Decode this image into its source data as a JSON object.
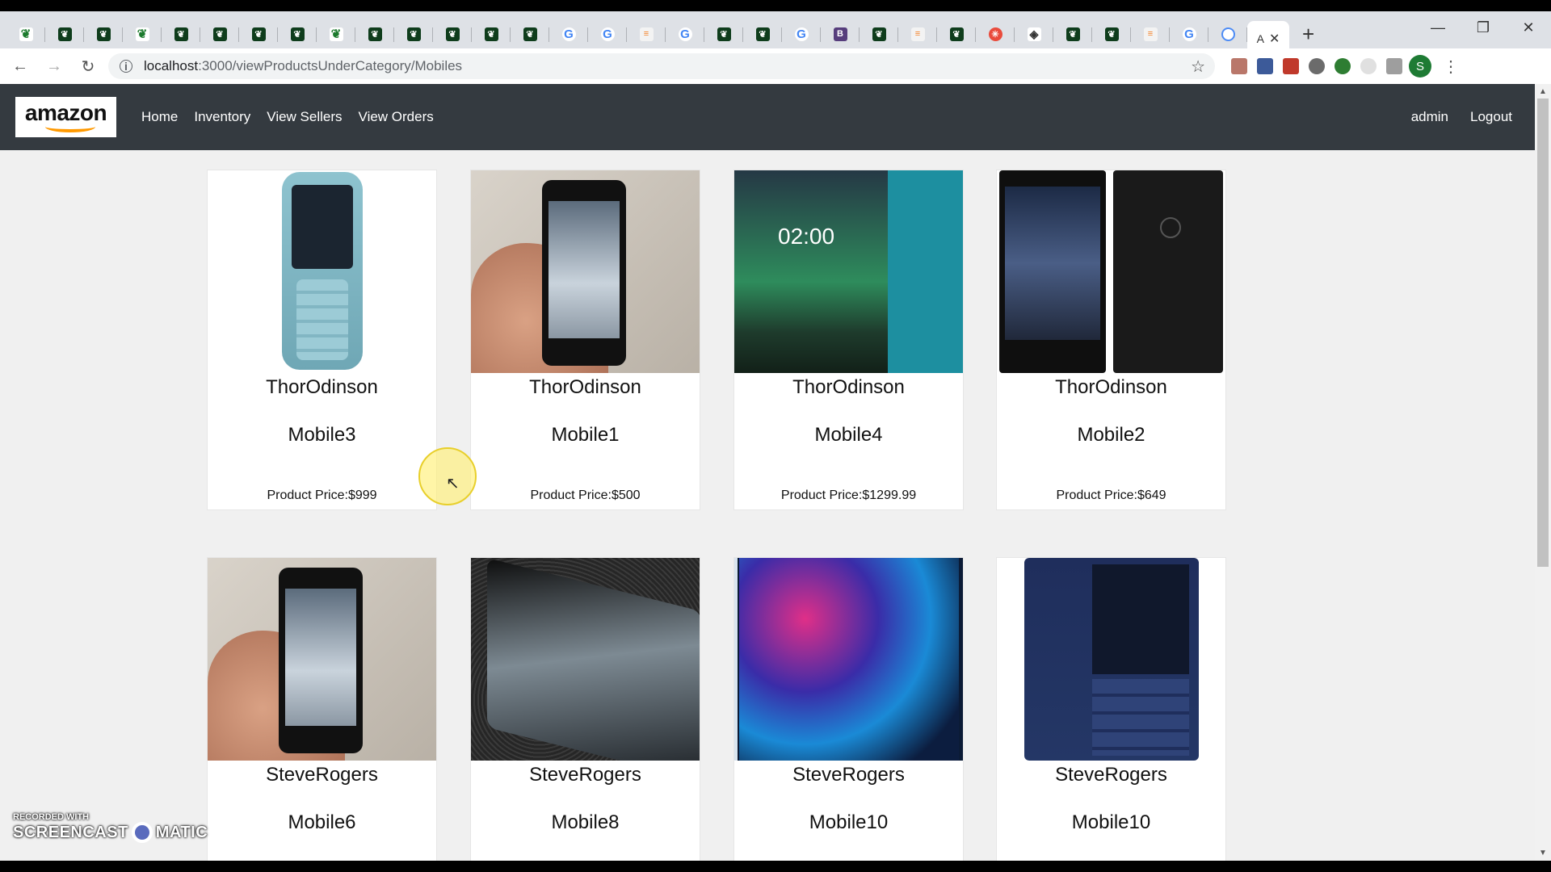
{
  "browser": {
    "url_host": "localhost",
    "url_path": ":3000/viewProductsUnderCategory/Mobiles",
    "active_tab_label": "A",
    "profile_initial": "S",
    "tab_icons": [
      "mongodb-leaf",
      "mongodb",
      "mongodb",
      "mongodb-leaf",
      "mongodb",
      "mongodb",
      "mongodb",
      "mongodb",
      "mongodb-leaf",
      "mongodb",
      "mongodb",
      "mongodb",
      "mongodb",
      "mongodb",
      "google",
      "google",
      "stackoverflow",
      "google",
      "mongodb",
      "mongodb",
      "google",
      "bootstrap",
      "mongodb",
      "stackoverflow",
      "mongodb",
      "snowflake",
      "diamond",
      "mongodb",
      "mongodb",
      "stackoverflow",
      "google",
      "circle"
    ]
  },
  "nav": {
    "logo_text": "amazon",
    "links": [
      "Home",
      "Inventory",
      "View Sellers",
      "View Orders"
    ],
    "user": "admin",
    "logout": "Logout"
  },
  "products": [
    {
      "seller": "ThorOdinson",
      "name": "Mobile3",
      "price": "Product Price:$999",
      "image": "nokia-feature-phone-blue"
    },
    {
      "seller": "ThorOdinson",
      "name": "Mobile1",
      "price": "Product Price:$500",
      "image": "hand-holding-nokia"
    },
    {
      "seller": "ThorOdinson",
      "name": "Mobile4",
      "price": "Product Price:$1299.99",
      "image": "nokia-aurora-teal"
    },
    {
      "seller": "ThorOdinson",
      "name": "Mobile2",
      "price": "Product Price:$649",
      "image": "pixel-front-back"
    },
    {
      "seller": "SteveRogers",
      "name": "Mobile6",
      "price": "",
      "image": "hand-holding-nokia"
    },
    {
      "seller": "SteveRogers",
      "name": "Mobile8",
      "price": "",
      "image": "phone-on-granite"
    },
    {
      "seller": "SteveRogers",
      "name": "Mobile10",
      "price": "",
      "image": "iphone-xr-blue"
    },
    {
      "seller": "SteveRogers",
      "name": "Mobile10",
      "price": "",
      "image": "nokia-feature-phone-navy"
    }
  ],
  "watermark": {
    "top": "RECORDED WITH",
    "left": "SCREENCAST",
    "right": "MATIC"
  }
}
